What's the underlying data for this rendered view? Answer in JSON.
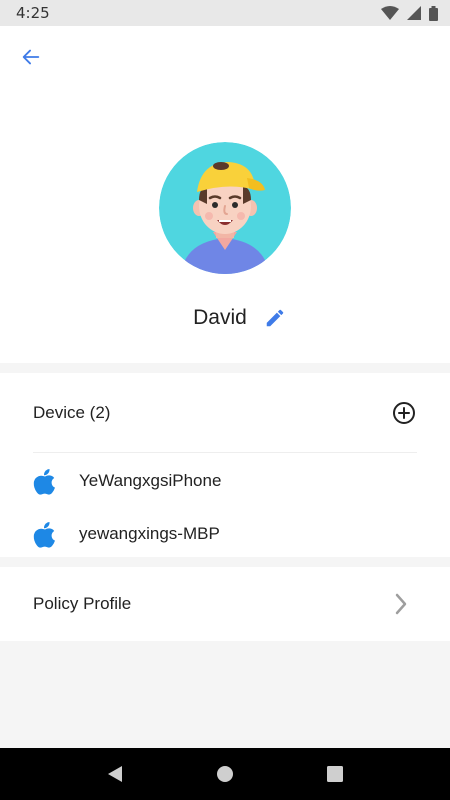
{
  "status_bar": {
    "time": "4:25"
  },
  "profile": {
    "name": "David"
  },
  "devices": {
    "title": "Device (2)",
    "items": [
      {
        "name": "YeWangxgsiPhone",
        "icon": "apple-icon"
      },
      {
        "name": "yewangxings-MBP",
        "icon": "apple-icon"
      }
    ]
  },
  "policy": {
    "label": "Policy Profile"
  },
  "colors": {
    "accent": "#3f7be8",
    "apple": "#1e88e5",
    "avatar_bg": "#4fd6e0"
  }
}
